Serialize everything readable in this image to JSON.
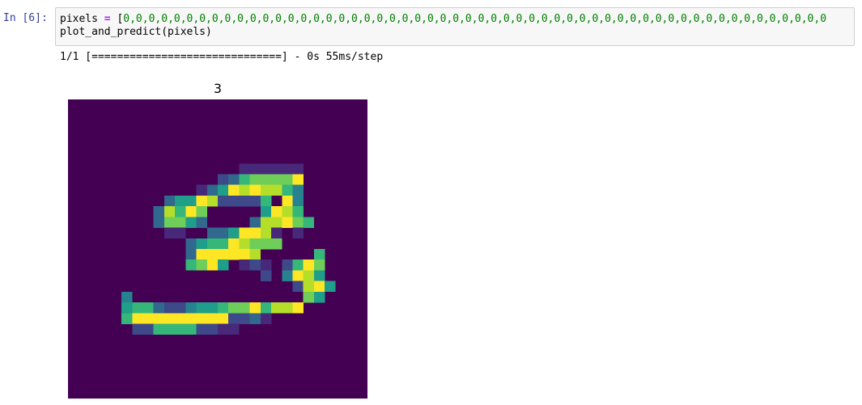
{
  "cell": {
    "prompt": "In [6]:",
    "code_line1_var": "pixels",
    "code_line1_op": "=",
    "code_line1_open": "[",
    "code_line1_values": "0,0,0,0,0,0,0,0,0,0,0,0,0,0,0,0,0,0,0,0,0,0,0,0,0,0,0,0,0,0,0,0,0,0,0,0,0,0,0,0,0,0,0,0,0,0,0,0,0,0,0,0,0,0,0,0",
    "code_line2": "plot_and_predict(pixels)",
    "output": "1/1 [==============================] - 0s 55ms/step"
  },
  "figure": {
    "title": "3",
    "colormap": [
      "#440154",
      "#482878",
      "#3e4989",
      "#31688e",
      "#26828e",
      "#1f9e89",
      "#35b779",
      "#6ece58",
      "#b5de2b",
      "#fde725"
    ],
    "image": [
      "............................",
      "............................",
      "............................",
      "............................",
      "............................",
      "............................",
      "................111111......",
      "..............23677779......",
      "............1359898864......",
      ".........3559822226.94......",
      "........38697.....5986......",
      "........37753....388976.....",
      ".........11..3359981.1......",
      "...........356698777........",
      "...........3999998.....6....",
      "...........6795.121.2697....",
      "..................2.4985....",
      ".....................2895...",
      ".....4................75....",
      ".....56632245567796889......",
      ".....69999999992231.........",
      "......2266662211............",
      "............................",
      "............................",
      "............................",
      "............................",
      "............................",
      "............................"
    ]
  }
}
